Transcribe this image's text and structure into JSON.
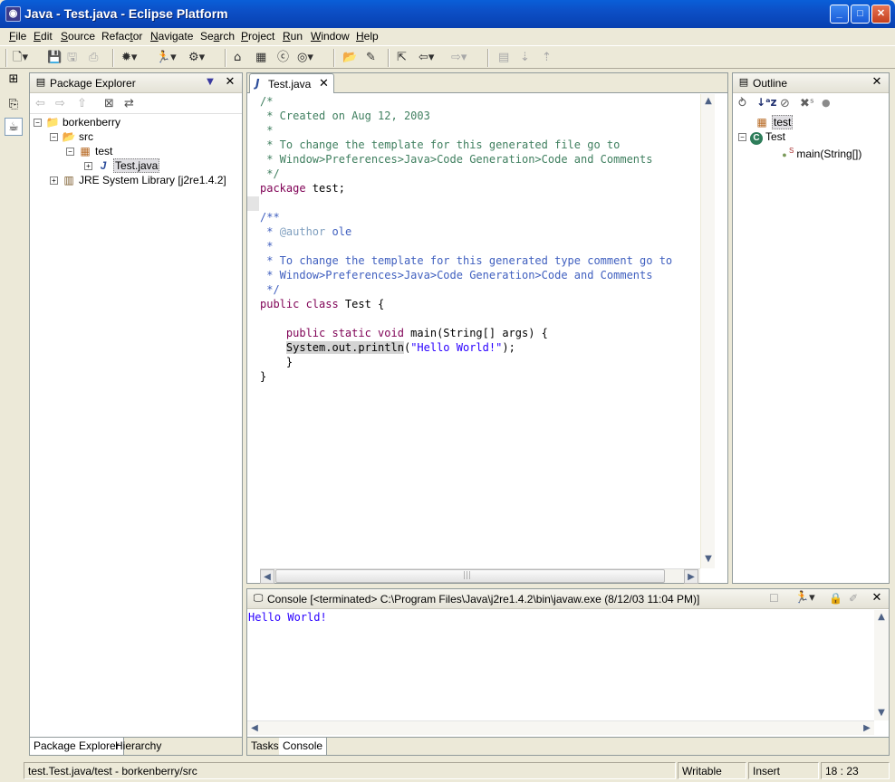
{
  "window": {
    "title": "Java - Test.java - Eclipse Platform",
    "minimize": "_",
    "maximize": "□",
    "close": "✕"
  },
  "menu": [
    {
      "pre": "",
      "u": "F",
      "post": "ile"
    },
    {
      "pre": "",
      "u": "E",
      "post": "dit"
    },
    {
      "pre": "",
      "u": "S",
      "post": "ource"
    },
    {
      "pre": "Refac",
      "u": "t",
      "post": "or"
    },
    {
      "pre": "",
      "u": "N",
      "post": "avigate"
    },
    {
      "pre": "Se",
      "u": "a",
      "post": "rch"
    },
    {
      "pre": "",
      "u": "P",
      "post": "roject"
    },
    {
      "pre": "",
      "u": "R",
      "post": "un"
    },
    {
      "pre": "",
      "u": "W",
      "post": "indow"
    },
    {
      "pre": "",
      "u": "H",
      "post": "elp"
    }
  ],
  "package_explorer": {
    "title": "Package Explorer",
    "tree": [
      {
        "label": "borkenberry",
        "twisty": "−",
        "icon": "📁",
        "icon_name": "project-icon"
      },
      {
        "label": "src",
        "twisty": "−",
        "icon": "📂",
        "icon_name": "source-folder-icon"
      },
      {
        "label": "test",
        "twisty": "−",
        "icon": "▦",
        "icon_name": "package-icon"
      },
      {
        "label": "Test.java",
        "twisty": "+",
        "icon": "J",
        "icon_name": "java-file-icon",
        "selected": true
      },
      {
        "label": "JRE System Library [j2re1.4.2]",
        "twisty": "+",
        "icon": "▥",
        "icon_name": "library-icon"
      }
    ],
    "tabs": [
      "Package Explorer",
      "Hierarchy"
    ]
  },
  "editor": {
    "tab_label": "Test.java",
    "close": "✕"
  },
  "outline": {
    "title": "Outline",
    "items": [
      {
        "label": "test",
        "icon": "▦",
        "icon_name": "package-icon"
      },
      {
        "label": "Test",
        "icon": "C",
        "icon_name": "class-icon"
      },
      {
        "label": "main(String[])",
        "icon": "●",
        "icon_name": "method-icon",
        "badge": "S"
      }
    ]
  },
  "console": {
    "title": "Console [<terminated> C:\\Program Files\\Java\\j2re1.4.2\\bin\\javaw.exe (8/12/03 11:04 PM)]",
    "output": "Hello World!",
    "tabs": [
      "Tasks",
      "Console"
    ]
  },
  "status": {
    "path": "test.Test.java/test - borkenberry/src",
    "writable": "Writable",
    "mode": "Insert",
    "position": "18 : 23"
  },
  "colors": {
    "comment": "#3f7f5f",
    "javadoc": "#3f5fbf",
    "keyword": "#7f0055",
    "string": "#2a00ff",
    "selection_highlight": "#d4d4d4"
  }
}
